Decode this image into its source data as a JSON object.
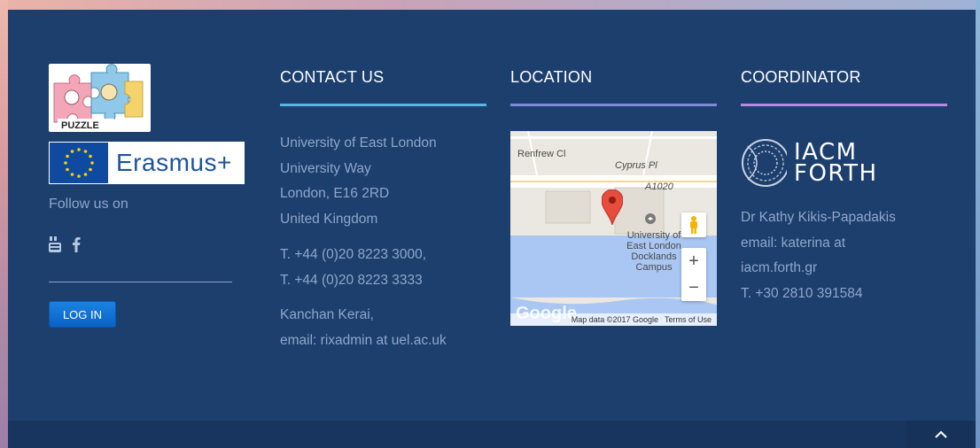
{
  "brand": {
    "puzzle_label": "PUZZLE",
    "erasmus_label": "Erasmus+",
    "follow_label": "Follow us on",
    "social_icons": [
      "youtube-icon",
      "facebook-icon"
    ],
    "login_label": "LOG IN"
  },
  "contact": {
    "heading": "CONTACT US",
    "address": [
      "University of East London",
      "University Way",
      "London, E16 2RD",
      "United Kingdom"
    ],
    "phones": [
      "T. +44 (0)20 8223 3000,",
      "T. +44 (0)20 8223 3333"
    ],
    "person": [
      "Kanchan Kerai,",
      "email: rixadmin at uel.ac.uk"
    ]
  },
  "location": {
    "heading": "LOCATION",
    "map": {
      "labels": {
        "renfrew": "Renfrew Cl",
        "cyprus": "Cyprus Pl",
        "road": "A1020",
        "campus": [
          "University of",
          "East London",
          "Docklands",
          "Campus"
        ],
        "google": "Google",
        "credit": "Map data ©2017 Google",
        "terms": "Terms of Use"
      },
      "zoom_in": "+",
      "zoom_out": "−"
    }
  },
  "coordinator": {
    "heading": "COORDINATOR",
    "logo_text": [
      "IACM",
      "FORTH"
    ],
    "lines": [
      "Dr Kathy Kikis-Papadakis",
      "email: katerina at",
      "iacm.forth.gr",
      "T. +30 2810 391584"
    ]
  },
  "colors": {
    "background": "#1c3f6e",
    "contact_accent": "#56b8e3",
    "location_accent": "#7e8ad8",
    "coordinator_accent": "#b58be3",
    "text_muted": "#8fa7c9",
    "login_button": "#0a62c6"
  }
}
